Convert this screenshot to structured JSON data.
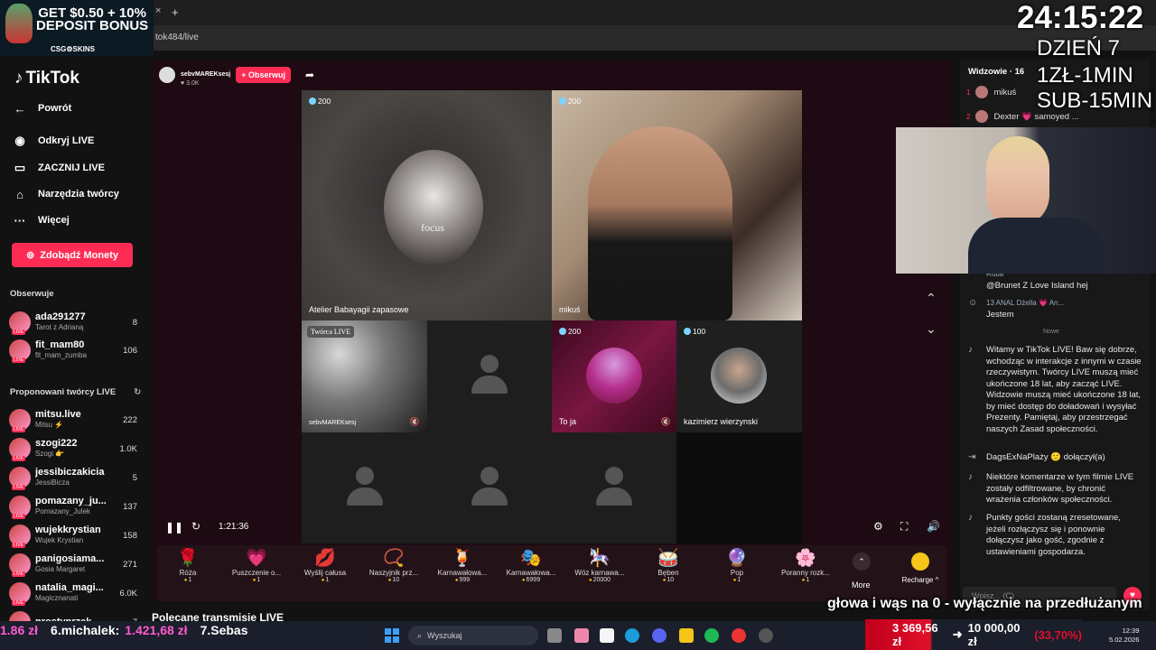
{
  "browser": {
    "address": "tok484/live",
    "new_tab": "+",
    "close_tab": "×"
  },
  "promo": {
    "line1": "GET $0.50 + 10%",
    "line2": "DEPOSIT BONUS",
    "brand": "CSG⚙SKINS"
  },
  "sidebar": {
    "logo": "TikTok",
    "back": "Powrót",
    "nav": [
      {
        "label": "Odkryj LIVE",
        "icon": "live-icon"
      },
      {
        "label": "ZACZNIJ LIVE",
        "icon": "camera-icon"
      },
      {
        "label": "Narzędzia twórcy",
        "icon": "home-icon"
      },
      {
        "label": "Więcej",
        "icon": "more-icon"
      }
    ],
    "coins_button": "Zdobądź Monety",
    "following_title": "Obserwuje",
    "following": [
      {
        "name": "ada291277",
        "sub": "Tarot z Adrianą",
        "count": "8"
      },
      {
        "name": "fit_mam80",
        "sub": "fit_mam_zumba",
        "count": "106"
      }
    ],
    "suggested_title": "Proponowani twórcy LIVE",
    "suggested": [
      {
        "name": "mitsu.live",
        "sub": "Mitsu ⚡",
        "count": "222"
      },
      {
        "name": "szogi222",
        "sub": "Szogi 👉",
        "count": "1.0K"
      },
      {
        "name": "jessibiczakicia",
        "sub": "JessiBicza",
        "count": "5"
      },
      {
        "name": "pomazany_ju...",
        "sub": "Pomazany_Julek",
        "count": "137"
      },
      {
        "name": "wujekkrystian",
        "sub": "Wujek Krystian",
        "count": "158"
      },
      {
        "name": "panigosiama...",
        "sub": "Gosia Margaret",
        "count": "271"
      },
      {
        "name": "natalia_magi...",
        "sub": "Magicznanati",
        "count": "6.0K"
      },
      {
        "name": "prostyprzek...",
        "sub": "",
        "count": "7"
      }
    ]
  },
  "stream": {
    "host": "sebvMAREKsesj",
    "likes": "♥ 3.0K",
    "follow": "+ Obserwuj",
    "tiles": [
      {
        "coin": "200",
        "name": "Atelier Babayagii zapasowe",
        "label": "focus"
      },
      {
        "coin": "200",
        "name": "mikuś"
      },
      {
        "badge": "Twórca LIVE",
        "name": "sebvMAREKsesj"
      },
      {
        "coin": "200",
        "name": "To ja"
      },
      {
        "coin": "100",
        "name": "kazimierz wierzynski"
      }
    ],
    "time": "1:21:36"
  },
  "gifts": [
    {
      "name": "Róża",
      "price": "1",
      "icon": "🌹"
    },
    {
      "name": "Puszczenie o...",
      "price": "1",
      "icon": "💗"
    },
    {
      "name": "Wyślij całusa",
      "price": "1",
      "icon": "💋"
    },
    {
      "name": "Naszyjnik prz...",
      "price": "10",
      "icon": "📿"
    },
    {
      "name": "Karnawałowa...",
      "price": "999",
      "icon": "🍹"
    },
    {
      "name": "Karnawałowa...",
      "price": "6999",
      "icon": "🎭"
    },
    {
      "name": "Wóz karnawa...",
      "price": "20000",
      "icon": "🎠"
    },
    {
      "name": "Bęben",
      "price": "10",
      "icon": "🥁"
    },
    {
      "name": "Pop",
      "price": "1",
      "icon": "🔮"
    },
    {
      "name": "Poranny rozk...",
      "price": "1",
      "icon": "🌸"
    }
  ],
  "gift_more": "More",
  "recharge": "Recharge ^",
  "panel": {
    "viewers": "Widzowie · 16",
    "viewer_list": [
      {
        "rank": "1",
        "name": "mikuś"
      },
      {
        "rank": "2",
        "name": "Dexter 💗 samoyed ..."
      }
    ],
    "chat": [
      {
        "icon": "avatar",
        "text": "@Brunet Z Love Island hej",
        "prefix": "Ruba"
      },
      {
        "icon": "avatar",
        "text": "Jestem",
        "prefix": "13 ANAL Dżella 💗 An..."
      },
      {
        "icon": "tiktok",
        "text": "Witamy w TikTok LIVE! Baw się dobrze, wchodząc w interakcje z innymi w czasie rzeczywistym. Twórcy LIVE muszą mieć ukończone 18 lat, aby zacząć LIVE. Widzowie muszą mieć ukończone 18 lat, by mieć dostęp do doładowań i wysyłać Prezenty. Pamiętaj, aby przestrzegać naszych Zasad społeczności."
      },
      {
        "icon": "join",
        "text": "DagsExNaPlaży 🙂 dołączył(a)"
      },
      {
        "icon": "tiktok",
        "text": "Niektóre komentarze w tym filmie LIVE zostały odfiltrowane, by chronić wrażenia członków społeczności."
      },
      {
        "icon": "tiktok",
        "text": "Punkty gości zostaną zresetowane, jeżeli rozłączysz się i ponownie dołączysz jako gość, zgodnie z ustawieniami gospodarza."
      }
    ],
    "new_label": "Nowe",
    "input_placeholder": "Wpisz... (C)"
  },
  "overlay": {
    "timer": "24:15:22",
    "day": "DZIEŃ 7",
    "rate1": "1ZŁ-1MIN",
    "rate2": "SUB-15MIN",
    "ticker": "głowa i wąs na 0 - wyłącznie na przedłużanym",
    "polecane": "Polecane transmisje LIVE"
  },
  "bottom": {
    "donors": [
      {
        "text": "1.86 zł"
      },
      {
        "text": "6.michalek:"
      },
      {
        "text": "1.421,68 zł"
      },
      {
        "text": "7.Sebas"
      }
    ],
    "search": "Wyszukaj",
    "goal_current": "3 369,56 zł",
    "goal_sep": "➜",
    "goal_target": "10 000,00 zł",
    "goal_pct": "(33,70%)",
    "time": "12:39",
    "date": "5.02.2026"
  },
  "colors": {
    "accent": "#fe2c55",
    "coin": "#f5c518",
    "main_bg": "#1d0a12"
  }
}
